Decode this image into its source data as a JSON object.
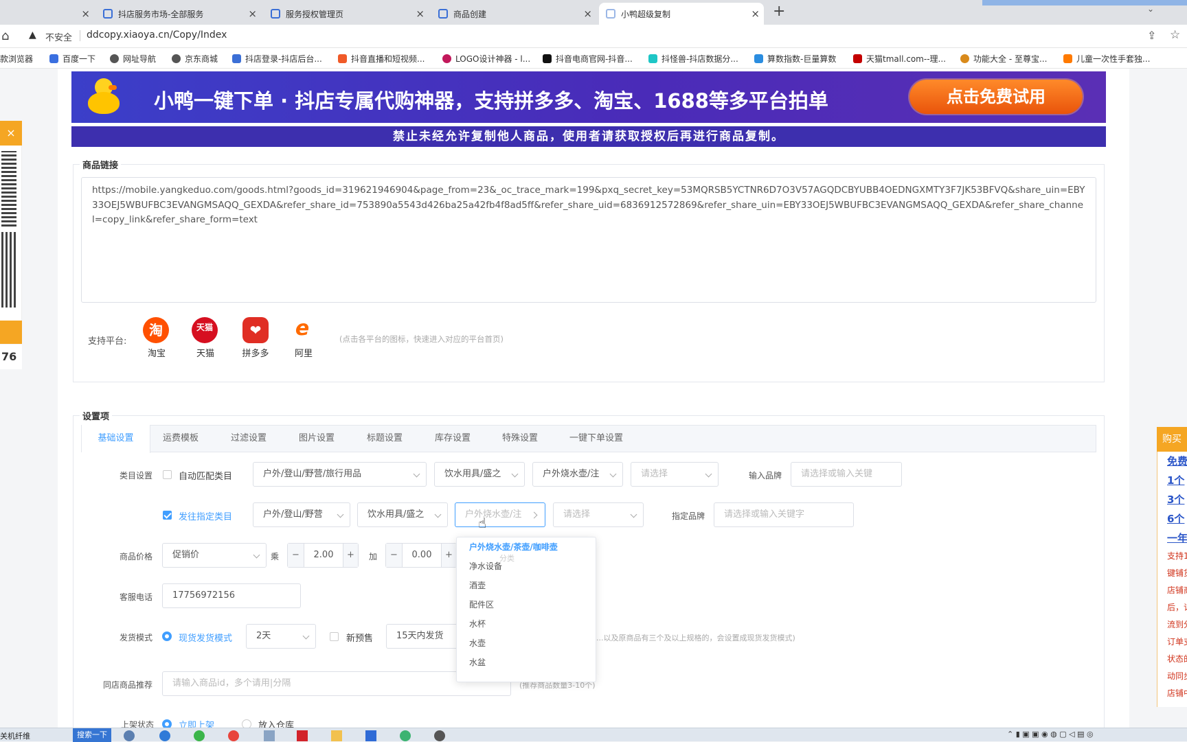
{
  "browser": {
    "tabs": [
      {
        "title": "抖店服务市场-全部服务"
      },
      {
        "title": "服务授权管理页"
      },
      {
        "title": "商品创建"
      },
      {
        "title": "小鸭超级复制"
      }
    ],
    "new_tab": "+",
    "security": "不安全",
    "url": "ddcopy.xiaoya.cn/Copy/Index",
    "bookmarks": [
      "款浏览器",
      "百度一下",
      "网址导航",
      "京东商城",
      "抖店登录-抖店后台...",
      "抖音直播和短视频...",
      "LOGO设计神器 - l...",
      "抖音电商官网-抖音...",
      "抖怪兽-抖店数据分...",
      "算数指数-巨量算数",
      "天猫tmall.com--理...",
      "功能大全 - 至尊宝...",
      "儿童一次性手套独..."
    ]
  },
  "banner": {
    "headline": "小鸭一键下单 · 抖店专属代购神器，支持拼多多、淘宝、1688等多平台拍单",
    "cta": "点击免费试用",
    "notice": "禁止未经允许复制他人商品，使用者请获取授权后再进行商品复制。"
  },
  "left_widget": {
    "close": "×",
    "count": "76"
  },
  "link_section": {
    "legend": "商品链接",
    "url_text": "https://mobile.yangkeduo.com/goods.html?goods_id=319621946904&page_from=23&_oc_trace_mark=199&pxq_secret_key=53MQRSB5YCTNR6D7O3V57AGQDCBYUBB4OEDNGXMTY3F7JK53BFVQ&share_uin=EBY33OEJ5WBUFBC3EVANGMSAQQ_GEXDA&refer_share_id=753890a5543d426ba25a42fb4f8ad5ff&refer_share_uid=6836912572869&refer_share_uin=EBY33OEJ5WBUFBC3EVANGMSAQQ_GEXDA&refer_share_channel=copy_link&refer_share_form=text",
    "platforms_label": "支持平台:",
    "platforms": [
      {
        "name": "淘宝",
        "glyph": "淘",
        "color": "#ff5000"
      },
      {
        "name": "天猫",
        "glyph": "天猫",
        "color": "#d60f20"
      },
      {
        "name": "拼多多",
        "glyph": "❤",
        "color": "#e02e24"
      },
      {
        "name": "阿里",
        "glyph": "e",
        "color": "#ff6a00"
      }
    ],
    "platforms_hint": "(点击各平台的图标，快速进入对应的平台首页)"
  },
  "settings": {
    "legend": "设置项",
    "tabs": [
      "基础设置",
      "运费模板",
      "过滤设置",
      "图片设置",
      "标题设置",
      "库存设置",
      "特殊设置",
      "一键下单设置"
    ],
    "category": {
      "label": "类目设置",
      "auto_label": "自动匹配类目",
      "sel1": "户外/登山/野营/旅行用品",
      "sel2": "饮水用具/盛之",
      "sel3": "户外烧水壶/注",
      "sel4": "请选择",
      "brand_label": "输入品牌",
      "brand_placeholder": "请选择或输入关键"
    },
    "assigned": {
      "label": "发往指定类目",
      "sel1": "户外/登山/野营",
      "sel2": "饮水用具/盛之",
      "sel3": "户外烧水壶/注",
      "sel4": "请选择",
      "brand_label": "指定品牌",
      "brand_placeholder": "请选择或输入关键字"
    },
    "dropdown": {
      "items": [
        "户外烧水壶/茶壶/咖啡壶",
        "净水设备",
        "酒壶",
        "配件区",
        "水杯",
        "水壶",
        "水盆"
      ],
      "ghost": "分类",
      "selected_index": 0
    },
    "price": {
      "label": "商品价格",
      "type": "促销价",
      "mult_label": "乘",
      "mult_value": "2.00",
      "add_label": "加",
      "add_value": "0.00",
      "minus": "−",
      "plus": "+"
    },
    "phone": {
      "label": "客服电话",
      "value": "17756972156"
    },
    "ship": {
      "label": "发货模式",
      "mode": "现货发货模式",
      "days": "2天",
      "presale_label": "新预售",
      "presale_value": "15天内发货",
      "note": "...以及原商品有三个及以上规格的，会设置成现货发货模式)"
    },
    "recommend": {
      "label": "同店商品推荐",
      "placeholder": "请输入商品id，多个请用|分隔",
      "hint": "(推荐商品数量3-10个)"
    },
    "status": {
      "label": "上架状态",
      "opt1": "立即上架",
      "opt2": "放入仓库"
    }
  },
  "right_panel": {
    "title": "购买",
    "links": [
      "免费",
      "1个",
      "3个",
      "6个",
      "一年"
    ],
    "text": [
      "支持1",
      "键铺货",
      "店铺商",
      "后，订",
      "流到分",
      "订单支",
      "状态的",
      "动同步",
      "店铺中"
    ]
  },
  "taskbar": {
    "left_text": "关机纤维",
    "search": "搜索一下"
  }
}
